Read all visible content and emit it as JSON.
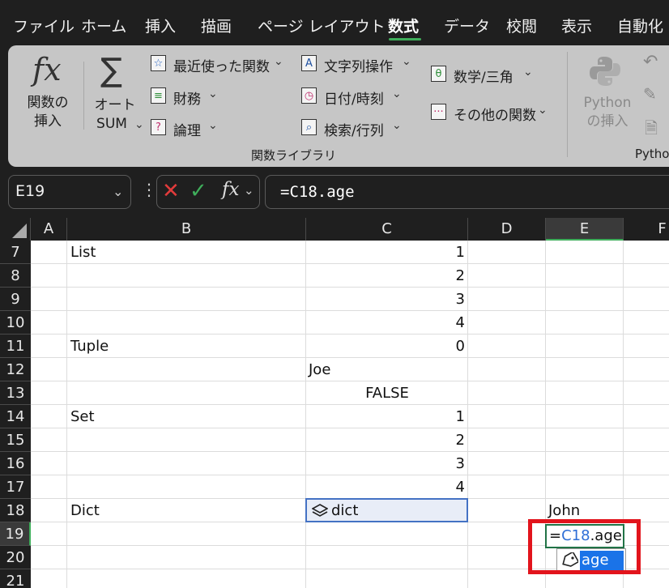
{
  "menu": {
    "tabs": [
      "ファイル",
      "ホーム",
      "挿入",
      "描画",
      "ページ レイアウト",
      "数式",
      "データ",
      "校閲",
      "表示",
      "自動化"
    ],
    "active_tab": "数式"
  },
  "ribbon": {
    "insert_function": {
      "line1": "関数の",
      "line2": "挿入"
    },
    "autosum": {
      "line1": "オート",
      "line2": "SUM"
    },
    "recent": "最近使った関数",
    "financial": "財務",
    "logical": "論理",
    "text": "文字列操作",
    "datetime": "日付/時刻",
    "lookup": "検索/行列",
    "math": "数学/三角",
    "more": "その他の関数",
    "python": {
      "line1": "Python",
      "line2": "の挿入"
    },
    "group_label": "関数ライブラリ",
    "python_group_partial": "Pytho"
  },
  "formula_bar": {
    "name_box": "E19",
    "formula": "=C18.age"
  },
  "grid": {
    "columns": [
      "A",
      "B",
      "C",
      "D",
      "E",
      "F"
    ],
    "selected_column": "E",
    "rows": [
      "7",
      "8",
      "9",
      "10",
      "11",
      "12",
      "13",
      "14",
      "15",
      "16",
      "17",
      "18",
      "19",
      "20",
      "21"
    ],
    "selected_row": "19",
    "cells": {
      "b7": "List",
      "c7": "1",
      "c8": "2",
      "c9": "3",
      "c10": "4",
      "b11": "Tuple",
      "c11": "0",
      "c12": "Joe",
      "c13": "FALSE",
      "b14": "Set",
      "c14": "1",
      "c15": "2",
      "c16": "3",
      "c17": "4",
      "b18": "Dict",
      "c18": "dict",
      "e18": "John"
    },
    "editing": {
      "prefix": "=",
      "ref": "C18",
      "suffix": ".age"
    },
    "autocomplete_item": "age"
  },
  "colors": {
    "accent_green": "#3fae5b",
    "highlight_red": "#e2141c",
    "ref_blue": "#2f6fd6",
    "autocomplete_blue": "#1a73e8"
  }
}
